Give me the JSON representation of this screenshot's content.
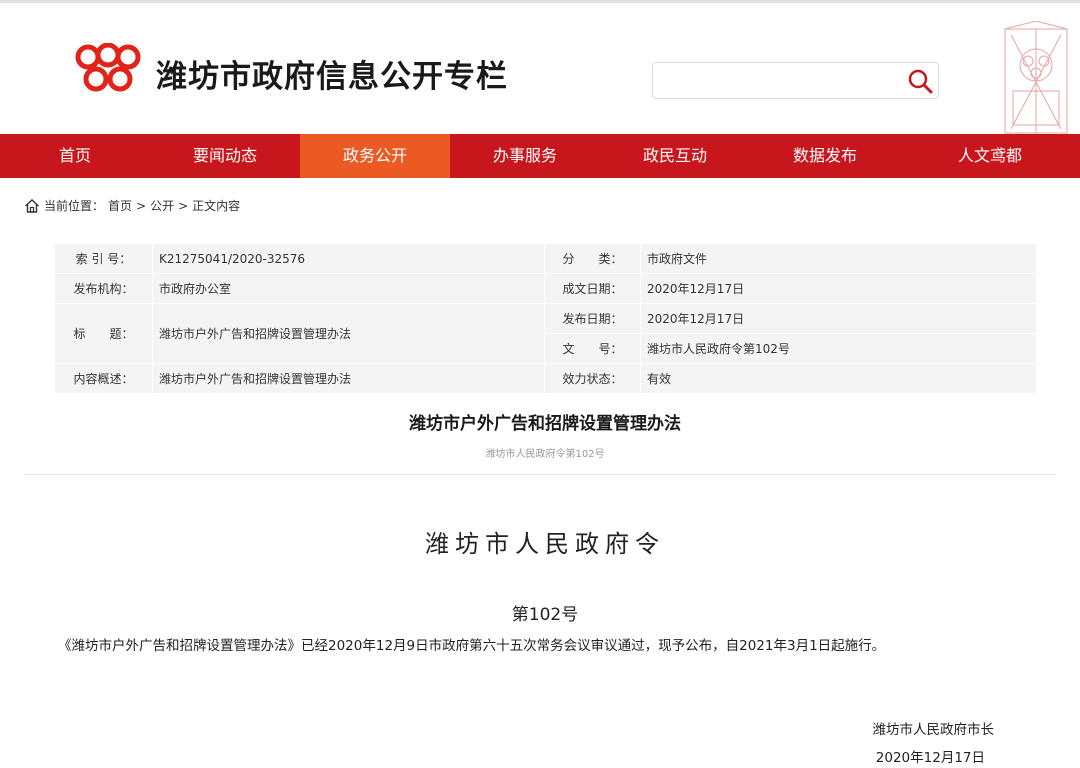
{
  "header": {
    "site_title": "潍坊市政府信息公开专栏",
    "search": {
      "value": "",
      "placeholder": ""
    },
    "brand_color": "#c8161d"
  },
  "nav": {
    "active_color": "#eb5a22",
    "items": [
      {
        "label": "首页"
      },
      {
        "label": "要闻动态"
      },
      {
        "label": "政务公开",
        "active": true
      },
      {
        "label": "办事服务"
      },
      {
        "label": "政民互动"
      },
      {
        "label": "数据发布"
      },
      {
        "label": "人文鸢都"
      }
    ]
  },
  "breadcrumb": {
    "prefix": "当前位置：",
    "items": [
      "首页",
      "公开",
      "正文内容"
    ],
    "separator": ">"
  },
  "meta": {
    "index_no_label": "索 引 号：",
    "index_no": "K21275041/2020-32576",
    "category_label": "分　　类：",
    "category": "市政府文件",
    "publisher_label": "发布机构：",
    "publisher": "市政府办公室",
    "created_label": "成文日期：",
    "created": "2020年12月17日",
    "title_label": "标　　题：",
    "title": "潍坊市户外广告和招牌设置管理办法",
    "published_label": "发布日期：",
    "published": "2020年12月17日",
    "doc_no_label": "文　　号：",
    "doc_no": "潍坊市人民政府令第102号",
    "summary_label": "内容概述：",
    "summary": "潍坊市户外广告和招牌设置管理办法",
    "status_label": "效力状态：",
    "status": "有效"
  },
  "document": {
    "title": "潍坊市户外广告和招牌设置管理办法",
    "subtitle": "潍坊市人民政府令第102号",
    "order_heading": "潍坊市人民政府令",
    "order_number": "第102号",
    "paragraph": "《潍坊市户外广告和招牌设置管理办法》已经2020年12月9日市政府第六十五次常务会议审议通过，现予公布，自2021年3月1日起施行。",
    "signer": "潍坊市人民政府市长",
    "sign_date": "2020年12月17日"
  }
}
